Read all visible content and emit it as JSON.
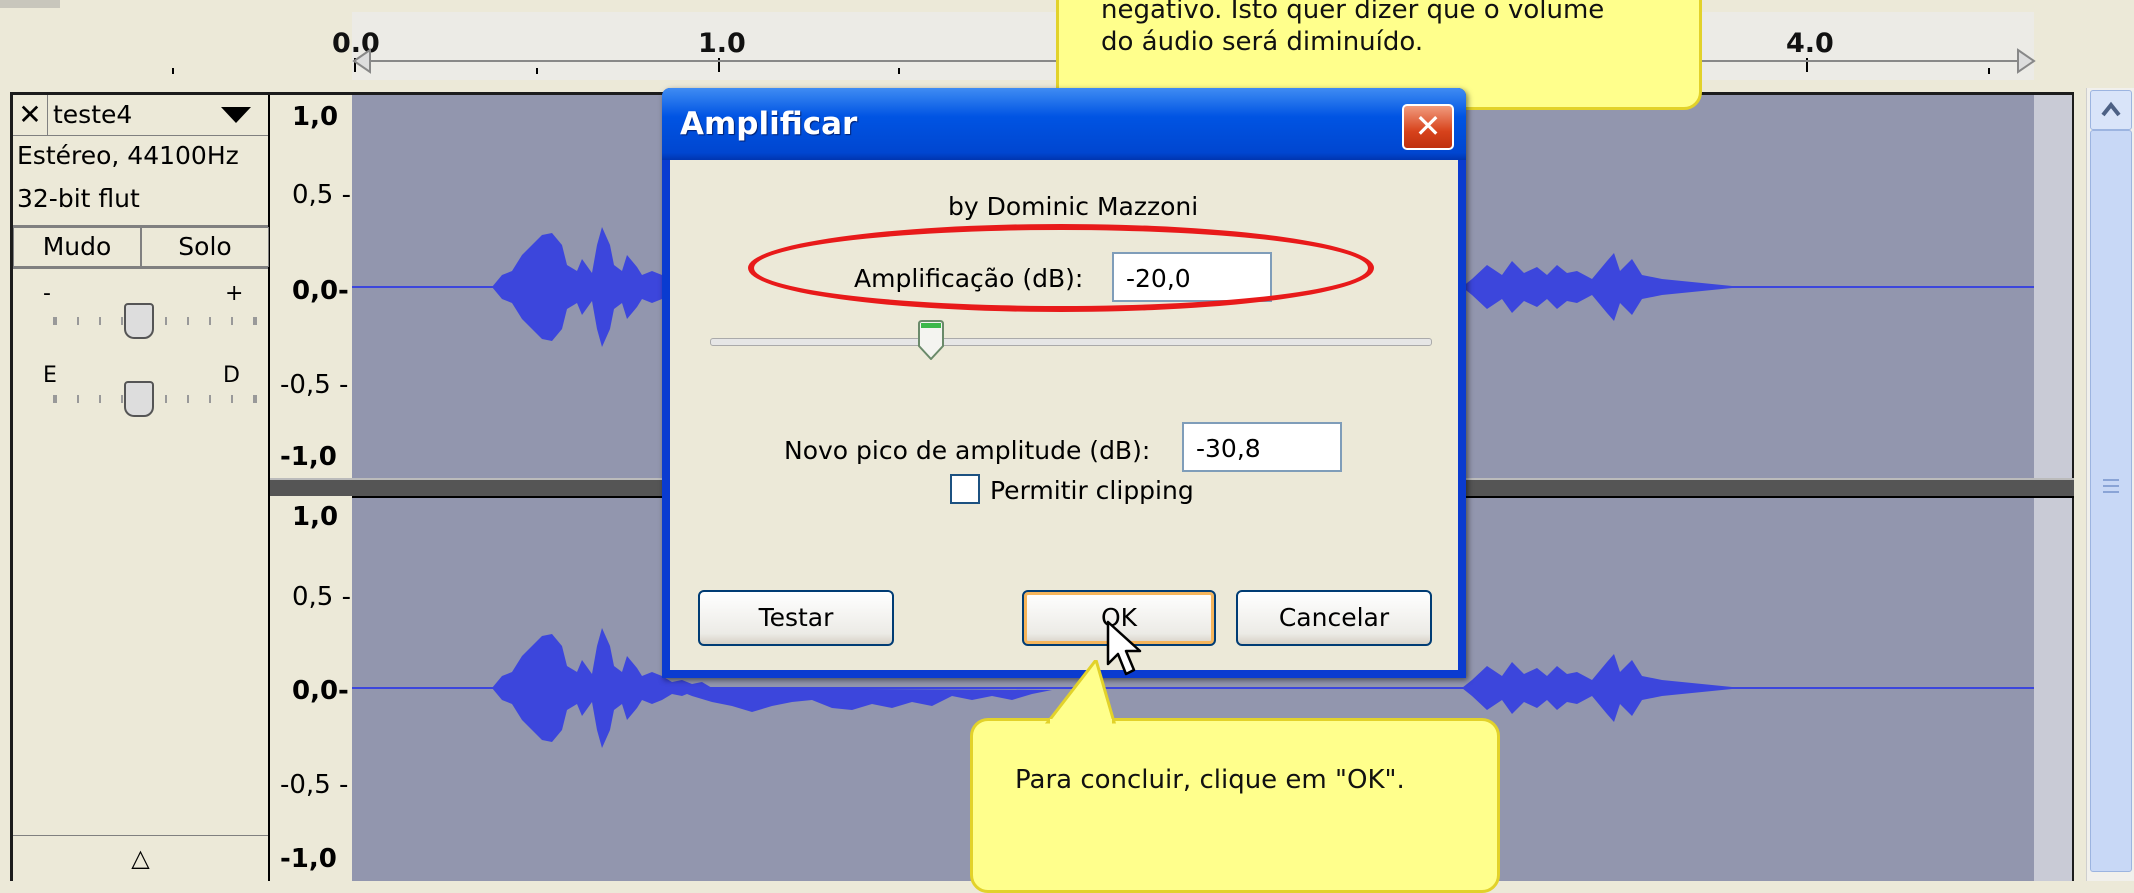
{
  "ruler": {
    "ticks": [
      "0.0",
      "1.0",
      "4.0"
    ]
  },
  "track": {
    "name": "teste4",
    "info_line1": "Estéreo, 44100Hz",
    "info_line2": "32-bit flut",
    "mute_label": "Mudo",
    "solo_label": "Solo",
    "gain_minus": "-",
    "gain_plus": "+",
    "pan_left": "E",
    "pan_right": "D",
    "collapse_label": "△"
  },
  "scale_top": [
    "1,0",
    "0,5 -",
    "0,0-",
    "-0,5 -",
    "-1,0"
  ],
  "scale_bottom": [
    "1,0",
    "0,5 -",
    "0,0-",
    "-0,5 -",
    "-1,0"
  ],
  "dialog": {
    "title": "Amplificar",
    "close_glyph": "✕",
    "author": "by Dominic Mazzoni",
    "amp_label": "Amplificação (dB):",
    "amp_value": "-20,0",
    "peak_label": "Novo pico de amplitude (dB):",
    "peak_value": "-30,8",
    "clip_label": "Permitir clipping",
    "test_button": "Testar",
    "ok_button": "OK",
    "cancel_button": "Cancelar"
  },
  "callout_top": {
    "line1": "negativo. Isto quer dizer que o volume",
    "line2": "do áudio será diminuído."
  },
  "callout_bottom": {
    "text": "Para concluir, clique em \"OK\"."
  },
  "colors": {
    "highlight_ellipse": "#e81a1a",
    "callout_fill": "#ffff8c",
    "waveform": "#3c46dc",
    "track_bg": "#9296ae"
  }
}
